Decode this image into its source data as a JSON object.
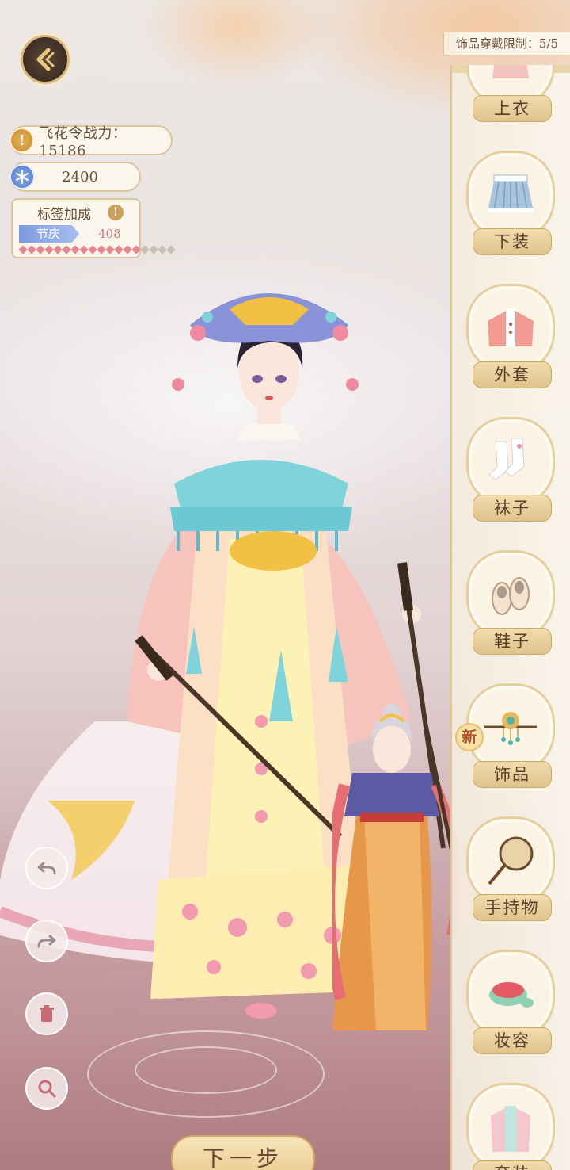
{
  "header": {
    "limit_label": "饰品穿戴限制：5/5"
  },
  "stats": {
    "power_icon": "!",
    "power_label": "飞花令战力：15186",
    "currency_value": "2400",
    "currency_icon": "snowflake-icon"
  },
  "tag_bonus": {
    "title": "标签加成",
    "info_icon": "!",
    "tag_name": "节庆",
    "tag_value": "408",
    "filled_dots": 14,
    "total_dots": 18
  },
  "categories": [
    {
      "label": "上衣",
      "icon": "top-icon"
    },
    {
      "label": "下装",
      "icon": "skirt-icon"
    },
    {
      "label": "外套",
      "icon": "coat-icon"
    },
    {
      "label": "袜子",
      "icon": "socks-icon"
    },
    {
      "label": "鞋子",
      "icon": "shoes-icon"
    },
    {
      "label": "饰品",
      "icon": "hairpin-icon",
      "badge": "新"
    },
    {
      "label": "手持物",
      "icon": "fan-icon"
    },
    {
      "label": "妆容",
      "icon": "makeup-icon"
    },
    {
      "label": "套装",
      "icon": "set-icon"
    }
  ],
  "tools": [
    "undo-icon",
    "redo-icon",
    "trash-icon",
    "zoom-icon"
  ],
  "footer": {
    "next_label": "下一步"
  },
  "colors": {
    "accent_gold": "#dcc59e",
    "label_brown": "#5a3f28",
    "tag_blue": "#7d9ae0",
    "tag_value_red": "#c97a7a"
  }
}
